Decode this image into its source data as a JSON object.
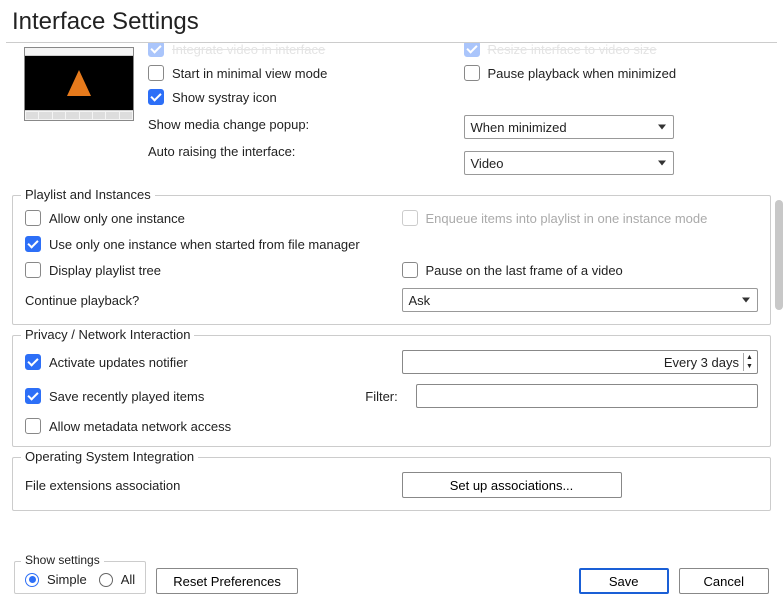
{
  "title": "Interface Settings",
  "top": {
    "truncated_left": "Integrate video in interface",
    "truncated_right": "Resize interface to video size",
    "start_minimal": "Start in minimal view mode",
    "pause_minimized": "Pause playback when minimized",
    "show_systray": "Show systray icon",
    "media_change_label": "Show media change popup:",
    "media_change_value": "When minimized",
    "auto_raise_label": "Auto raising the interface:",
    "auto_raise_value": "Video"
  },
  "playlist": {
    "legend": "Playlist and Instances",
    "allow_one": "Allow only one instance",
    "enqueue": "Enqueue items into playlist in one instance mode",
    "use_one_fm": "Use only one instance when started from file manager",
    "display_tree": "Display playlist tree",
    "pause_last": "Pause on the last frame of a video",
    "continue_label": "Continue playback?",
    "continue_value": "Ask"
  },
  "privacy": {
    "legend": "Privacy / Network Interaction",
    "activate_updates": "Activate updates notifier",
    "every_value": "Every 3 days",
    "save_recent": "Save recently played items",
    "filter_label": "Filter:",
    "filter_value": "",
    "allow_metadata": "Allow metadata network access"
  },
  "os": {
    "legend": "Operating System Integration",
    "file_ext": "File extensions association",
    "setup_btn": "Set up associations..."
  },
  "footer": {
    "show_settings": "Show settings",
    "simple": "Simple",
    "all": "All",
    "reset": "Reset Preferences",
    "save": "Save",
    "cancel": "Cancel"
  }
}
